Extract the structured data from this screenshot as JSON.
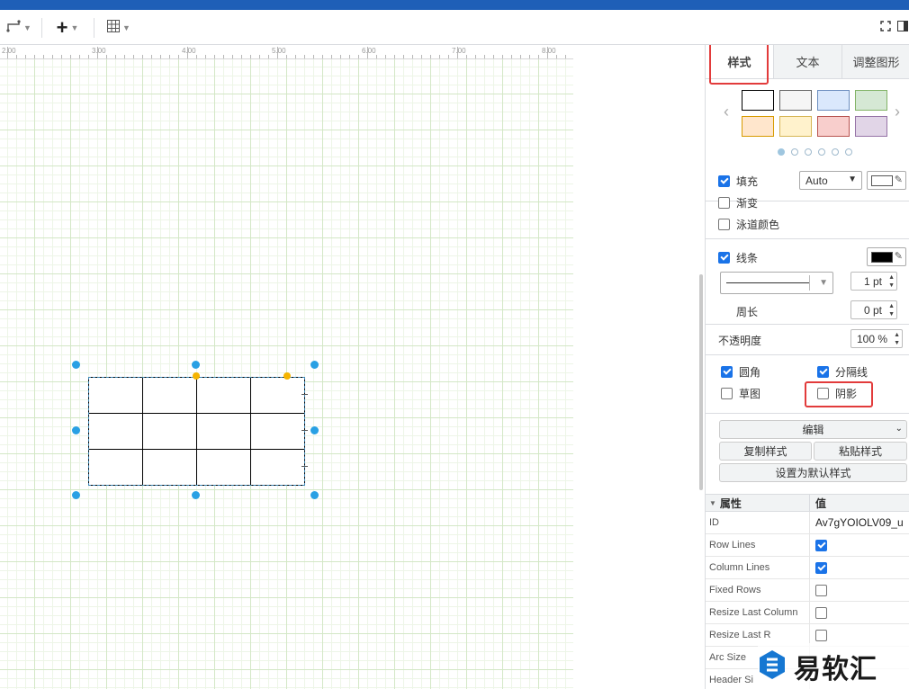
{
  "toolbar": {
    "waypoint_icon": "waypoint-icon",
    "add_icon": "plus-icon",
    "table_icon": "table-icon",
    "fullscreen_icon": "fullscreen-icon",
    "panel_toggle_icon": "panel-toggle-icon"
  },
  "ruler": {
    "labels": [
      "2.00",
      "3.00",
      "4.00",
      "5.00",
      "6.00",
      "7.00",
      "8.00"
    ]
  },
  "canvas": {
    "grid_color": "#d3e7c6",
    "selection_color": "#29a0e4",
    "table_rows": 3,
    "table_cols": 4
  },
  "panel": {
    "tabs": [
      {
        "label": "样式"
      },
      {
        "label": "文本"
      },
      {
        "label": "调整图形"
      }
    ],
    "swatch_colors": [
      "#ffffff",
      "#f5f5f5",
      "#dae8fc",
      "#d5e8d4",
      "#ffe6cc",
      "#fff2cc",
      "#f8cecc",
      "#e1d5e7"
    ],
    "swatch_borders": [
      "#000000",
      "#666666",
      "#6c8ebf",
      "#82b366",
      "#d79b00",
      "#d6b656",
      "#b85450",
      "#9673a6"
    ],
    "fill": {
      "label": "填充",
      "checked": true,
      "select": "Auto",
      "color": "#ffffff"
    },
    "gradient": {
      "label": "渐变",
      "checked": false
    },
    "swimlane": {
      "label": "泳道颜色",
      "checked": false
    },
    "line": {
      "label": "线条",
      "checked": true,
      "color": "#000000",
      "width": "1 pt"
    },
    "perimeter": {
      "label": "周长",
      "value": "0 pt"
    },
    "opacity": {
      "label": "不透明度",
      "value": "100 %"
    },
    "rounded": {
      "label": "圆角",
      "checked": true
    },
    "divider_lines": {
      "label": "分隔线",
      "checked": true
    },
    "sketch": {
      "label": "草图",
      "checked": false
    },
    "shadow": {
      "label": "阴影",
      "checked": false
    },
    "edit_select": "编辑",
    "copy_style": "复制样式",
    "paste_style": "粘贴样式",
    "set_default": "设置为默认样式",
    "props_header": {
      "name": "属性",
      "value": "值"
    },
    "properties": [
      {
        "name": "ID",
        "value": "Av7gYOIOLV09_u",
        "type": "text"
      },
      {
        "name": "Row Lines",
        "checked": true,
        "type": "checkbox"
      },
      {
        "name": "Column Lines",
        "checked": true,
        "type": "checkbox"
      },
      {
        "name": "Fixed Rows",
        "checked": false,
        "type": "checkbox"
      },
      {
        "name": "Resize Last Column",
        "checked": false,
        "type": "checkbox"
      },
      {
        "name": "Resize Last R",
        "checked": false,
        "type": "checkbox"
      },
      {
        "name": "Arc Size",
        "value": "",
        "type": "text"
      },
      {
        "name": "Header Si",
        "value": "",
        "type": "text"
      }
    ]
  },
  "watermark": {
    "text": "易软汇"
  }
}
